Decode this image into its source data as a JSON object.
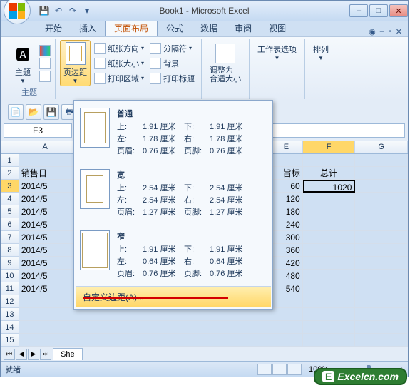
{
  "title": "Book1 - Microsoft Excel",
  "tabs": [
    "开始",
    "插入",
    "页面布局",
    "公式",
    "数据",
    "审阅",
    "视图"
  ],
  "active_tab_index": 2,
  "ribbon": {
    "themes_label": "主题",
    "margins_label": "页边距",
    "orientation": "纸张方向",
    "size": "纸张大小",
    "print_area": "打印区域",
    "breaks": "分隔符",
    "background": "背景",
    "print_titles": "打印标题",
    "scale_fit": "调整为\n合适大小",
    "sheet_options": "工作表选项",
    "arrange": "排列"
  },
  "dropdown": {
    "normal": {
      "title": "普通",
      "top": "上:",
      "top_v": "1.91 厘米",
      "bottom": "下:",
      "bottom_v": "1.91 厘米",
      "left": "左:",
      "left_v": "1.78 厘米",
      "right": "右:",
      "right_v": "1.78 厘米",
      "header": "页眉:",
      "header_v": "0.76 厘米",
      "footer": "页脚:",
      "footer_v": "0.76 厘米"
    },
    "wide": {
      "title": "宽",
      "top": "上:",
      "top_v": "2.54 厘米",
      "bottom": "下:",
      "bottom_v": "2.54 厘米",
      "left": "左:",
      "left_v": "2.54 厘米",
      "right": "右:",
      "right_v": "2.54 厘米",
      "header": "页眉:",
      "header_v": "1.27 厘米",
      "footer": "页脚:",
      "footer_v": "1.27 厘米"
    },
    "narrow": {
      "title": "窄",
      "top": "上:",
      "top_v": "1.91 厘米",
      "bottom": "下:",
      "bottom_v": "1.91 厘米",
      "left": "左:",
      "left_v": "0.64 厘米",
      "right": "右:",
      "right_v": "0.64 厘米",
      "header": "页眉:",
      "header_v": "0.76 厘米",
      "footer": "页脚:",
      "footer_v": "0.76 厘米"
    },
    "custom": "自定义边距(A)..."
  },
  "name_box": "F3",
  "columns": [
    "A",
    "E",
    "F",
    "G"
  ],
  "rows": [
    {
      "n": "1",
      "a": "",
      "e": "",
      "f": "",
      "g": ""
    },
    {
      "n": "2",
      "a": "销售日",
      "e": "旨标",
      "f": "总计",
      "g": ""
    },
    {
      "n": "3",
      "a": "2014/5",
      "e": "60",
      "f": "1020",
      "g": ""
    },
    {
      "n": "4",
      "a": "2014/5",
      "e": "120",
      "f": "",
      "g": ""
    },
    {
      "n": "5",
      "a": "2014/5",
      "e": "180",
      "f": "",
      "g": ""
    },
    {
      "n": "6",
      "a": "2014/5",
      "e": "240",
      "f": "",
      "g": ""
    },
    {
      "n": "7",
      "a": "2014/5",
      "e": "300",
      "f": "",
      "g": ""
    },
    {
      "n": "8",
      "a": "2014/5",
      "e": "360",
      "f": "",
      "g": ""
    },
    {
      "n": "9",
      "a": "2014/5",
      "e": "420",
      "f": "",
      "g": ""
    },
    {
      "n": "10",
      "a": "2014/5",
      "e": "480",
      "f": "",
      "g": ""
    },
    {
      "n": "11",
      "a": "2014/5",
      "e": "540",
      "f": "",
      "g": ""
    },
    {
      "n": "12",
      "a": "",
      "e": "",
      "f": "",
      "g": ""
    },
    {
      "n": "13",
      "a": "",
      "e": "",
      "f": "",
      "g": ""
    },
    {
      "n": "14",
      "a": "",
      "e": "",
      "f": "",
      "g": ""
    },
    {
      "n": "15",
      "a": "",
      "e": "",
      "f": "",
      "g": ""
    }
  ],
  "sheet_tab": "She",
  "status": "就绪",
  "zoom": "100%",
  "watermark": "Excelcn.com"
}
